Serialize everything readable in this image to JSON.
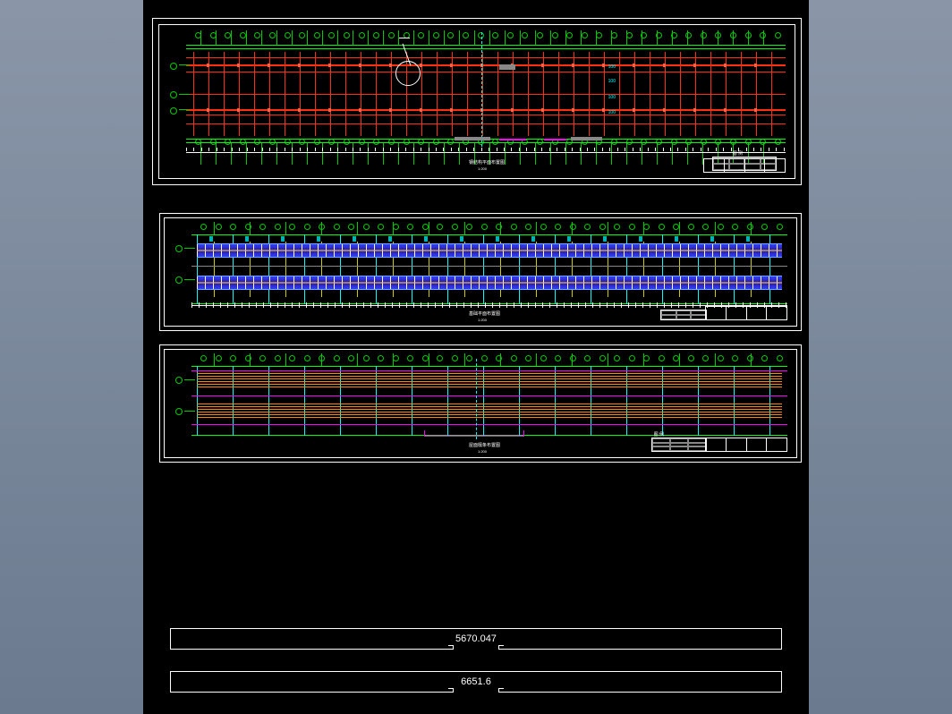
{
  "dimensions": {
    "bar1": "5670.047",
    "bar2": "6651.6"
  },
  "plans": {
    "top": {
      "title": "钢结构平面布置图",
      "subtitle": "1:200",
      "legend": "图 例"
    },
    "mid": {
      "title": "基础平面布置图",
      "subtitle": "1:200"
    },
    "bot": {
      "title": "屋面檩条布置图",
      "subtitle": "1:200",
      "legend": "图 例"
    }
  },
  "grid_labels": [
    "1",
    "2",
    "3",
    "4",
    "5",
    "6",
    "7",
    "8",
    "9",
    "10",
    "11",
    "12",
    "13",
    "14",
    "15",
    "16",
    "17",
    "18",
    "19",
    "20",
    "21",
    "22",
    "23",
    "24",
    "25",
    "26",
    "27",
    "28",
    "29",
    "30",
    "31",
    "32",
    "33",
    "34",
    "35",
    "36",
    "37",
    "38",
    "39",
    "40"
  ],
  "dim_values_top": [
    "100",
    "100",
    "100",
    "100"
  ],
  "colors": {
    "primary_grid": "#ff3010",
    "secondary_grid": "#00ff00",
    "accent": "#00ffff",
    "foundation": "#4040ff",
    "purlin": "#ff8800",
    "marker": "#ff00ff"
  }
}
